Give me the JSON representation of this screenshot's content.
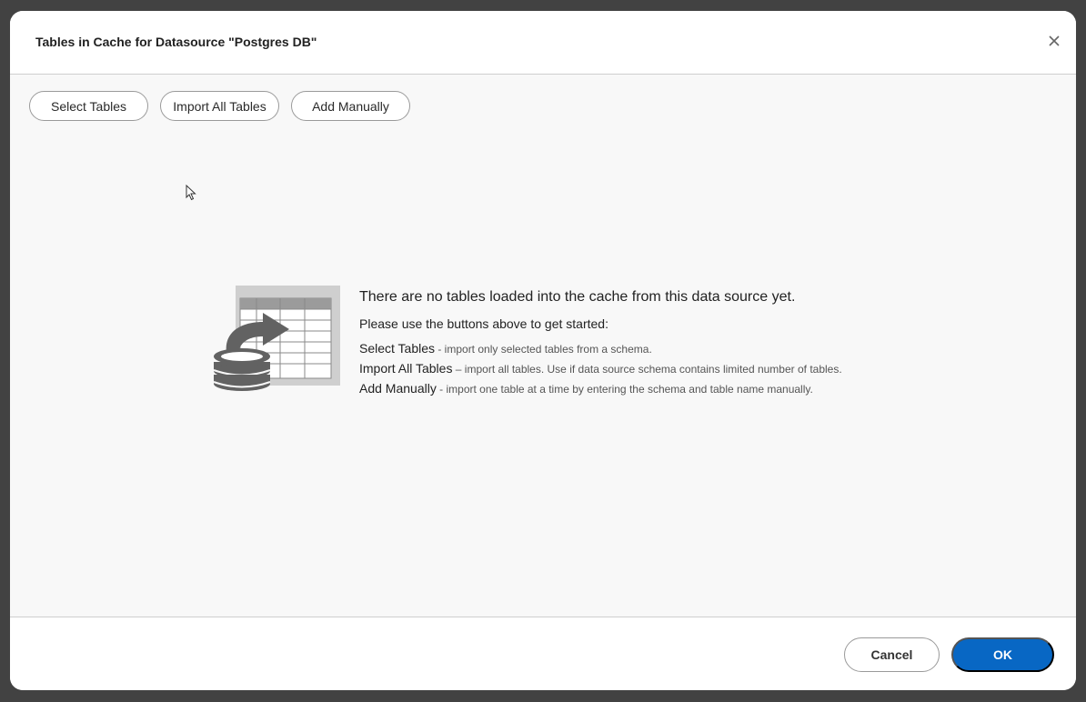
{
  "dialog": {
    "title": "Tables in Cache for Datasource \"Postgres DB\"",
    "close_icon": "close-icon"
  },
  "toolbar": {
    "select_tables": "Select Tables",
    "import_all_tables": "Import All Tables",
    "add_manually": "Add Manually"
  },
  "empty_state": {
    "illustration_icon": "database-table-import-icon",
    "title": "There are no tables loaded into the cache from this data source yet.",
    "subtitle": "Please use the buttons above to get started:",
    "items": [
      {
        "name": "Select Tables",
        "desc": " - import only selected tables from a schema."
      },
      {
        "name": "Import All Tables",
        "desc": " – import all tables. Use if data source schema contains limited number of tables."
      },
      {
        "name": "Add Manually",
        "desc": " - import one table at a time by entering the schema and table name manually."
      }
    ]
  },
  "footer": {
    "cancel": "Cancel",
    "ok": "OK"
  },
  "colors": {
    "primary": "#0867c4",
    "body_bg": "#f8f8f8",
    "backdrop": "#424242"
  }
}
